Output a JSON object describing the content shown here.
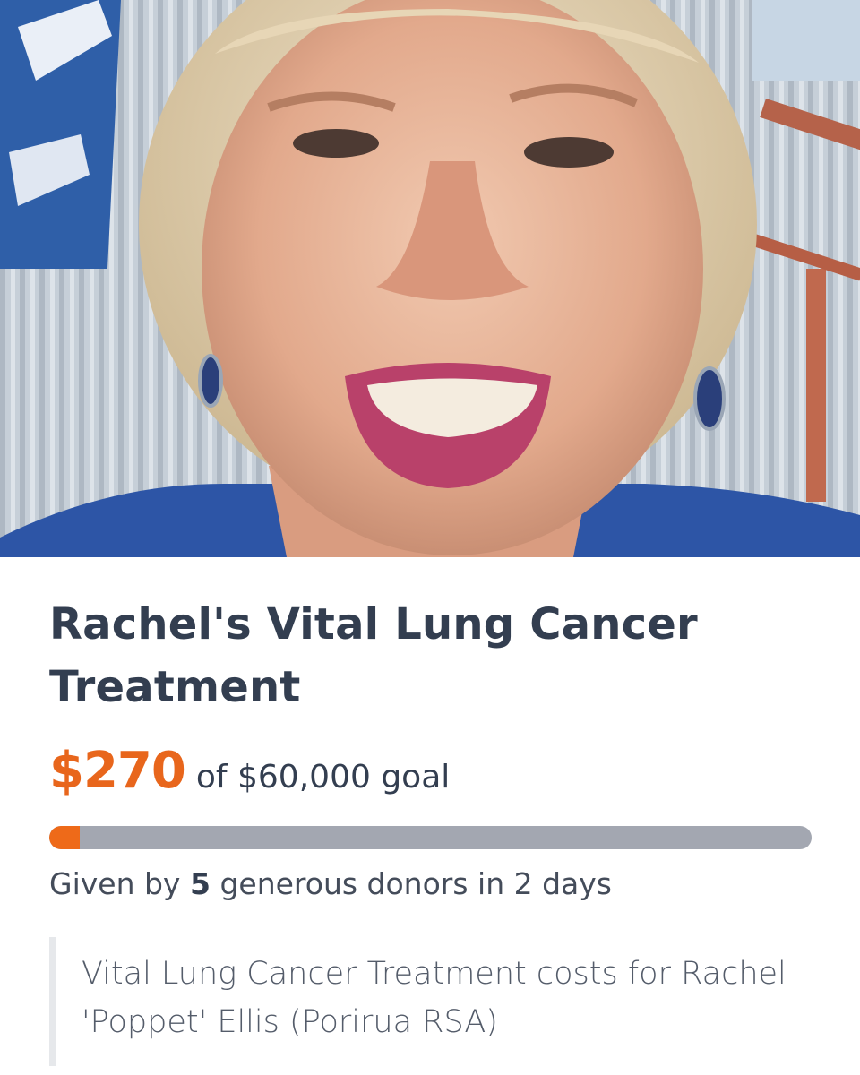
{
  "campaign": {
    "title": "Rachel's Vital Lung Cancer Treatment",
    "raised": "$270",
    "goal_text": "of $60,000 goal",
    "progress_fraction": 0.0045,
    "donors": {
      "prefix": "Given by",
      "count": "5",
      "suffix": "generous donors in 2 days"
    },
    "description": "Vital Lung Cancer Treatment costs for Rachel 'Poppet' Ellis (Porirua RSA)"
  },
  "colors": {
    "accent": "#e8661c",
    "text_dark": "#333e50",
    "progress_track": "#a3a7b1"
  }
}
